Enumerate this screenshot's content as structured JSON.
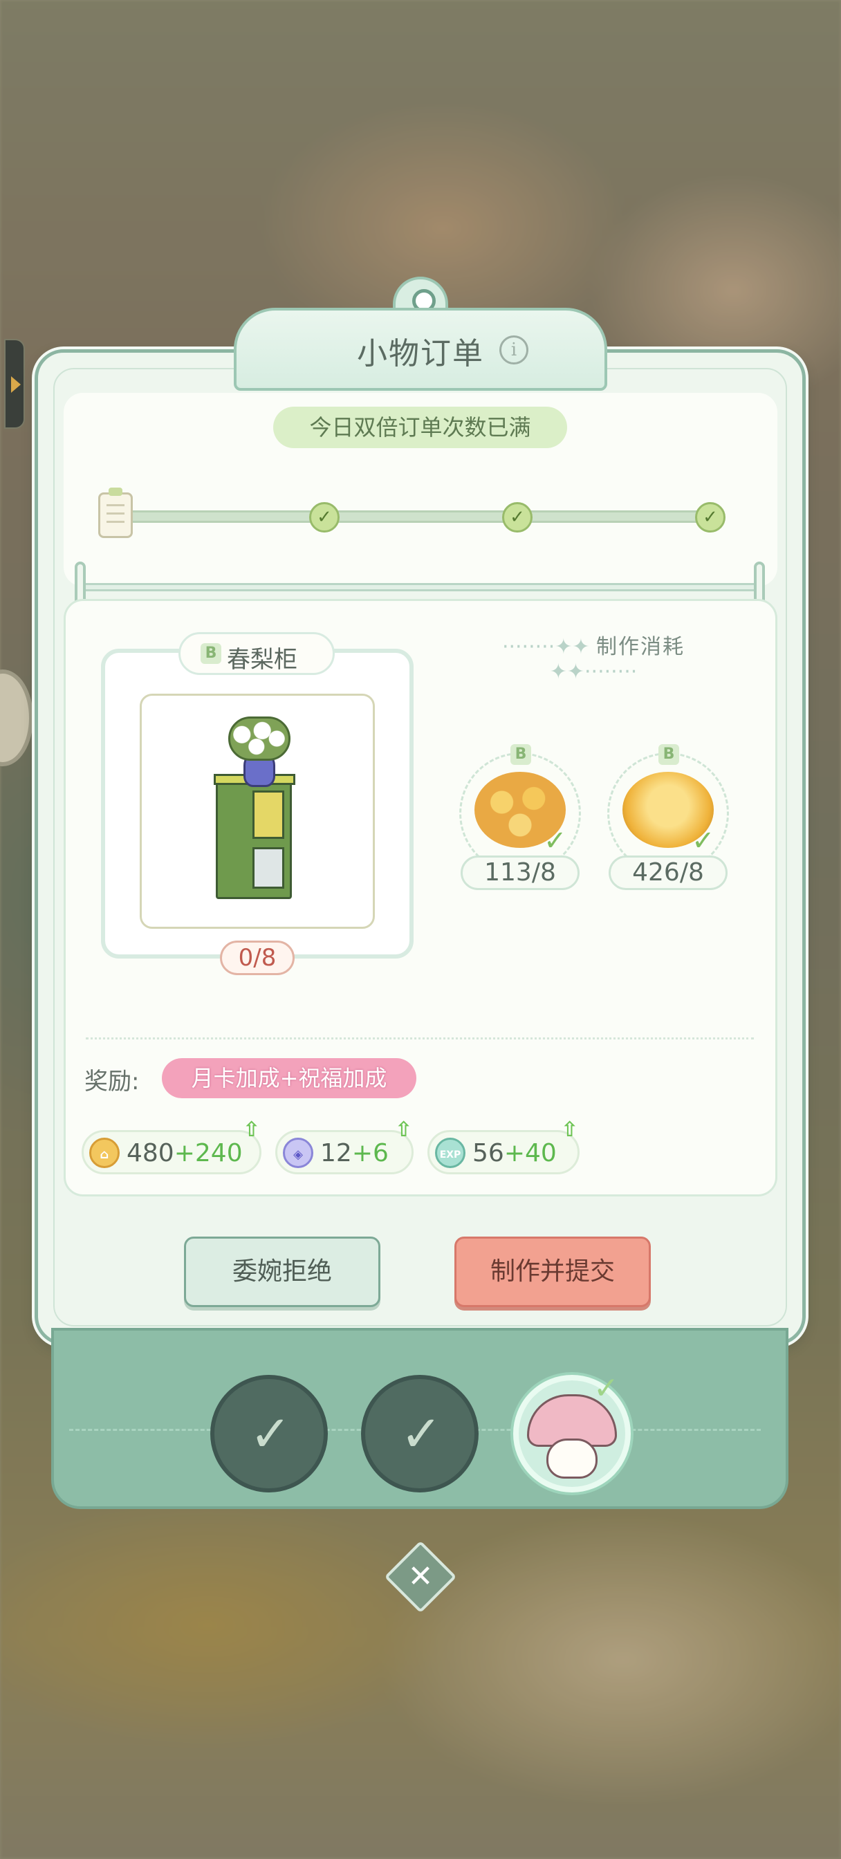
{
  "header": {
    "title": "小物订单",
    "info_icon": "info-icon"
  },
  "progress": {
    "banner": "今日双倍订单次数已满",
    "steps": [
      {
        "state": "completed",
        "icon": "check-icon"
      },
      {
        "state": "completed",
        "icon": "check-icon"
      },
      {
        "state": "completed",
        "icon": "check-icon"
      }
    ]
  },
  "item": {
    "rarity": "B",
    "name": "春梨柜",
    "count": "0/8"
  },
  "materials": {
    "title": "制作消耗",
    "items": [
      {
        "rarity": "B",
        "icon": "yellow-daisy-bouquet-icon",
        "count": "113/8",
        "satisfied": true
      },
      {
        "rarity": "B",
        "icon": "golden-carnation-icon",
        "count": "426/8",
        "satisfied": true
      }
    ]
  },
  "rewards": {
    "label": "奖励:",
    "bonus_banner": "月卡加成+祝福加成",
    "items": [
      {
        "icon": "coin-icon",
        "base": "480",
        "bonus": "+240"
      },
      {
        "icon": "blue-gem-icon",
        "base": "12",
        "bonus": "+6"
      },
      {
        "icon": "exp-icon",
        "icon_text": "EXP",
        "base": "56",
        "bonus": "+40"
      }
    ]
  },
  "buttons": {
    "reject": "委婉拒绝",
    "submit": "制作并提交"
  },
  "queue": {
    "slots": [
      {
        "state": "completed",
        "icon": "check-icon"
      },
      {
        "state": "completed",
        "icon": "check-icon"
      },
      {
        "state": "active",
        "icon": "mushroom-avatar-icon"
      }
    ]
  },
  "colors": {
    "panel": "#eef6ee",
    "accent_green": "#5db84e",
    "submit": "#f2a190",
    "reject": "#dcede3",
    "bonus_pink": "#f3a2bb",
    "count_red": "#c05a4e"
  }
}
